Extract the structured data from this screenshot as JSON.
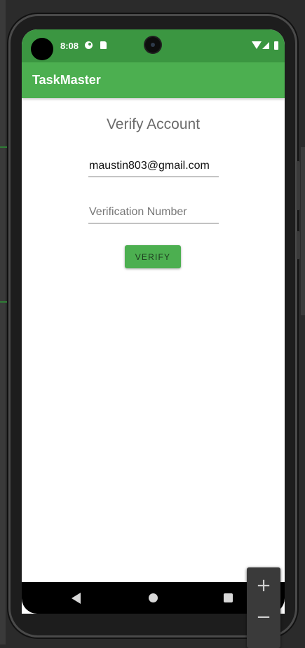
{
  "status_bar": {
    "time": "8:08"
  },
  "app_bar": {
    "title": "TaskMaster"
  },
  "form": {
    "heading": "Verify Account",
    "email_value": "maustin803@gmail.com",
    "code_placeholder": "Verification Number",
    "verify_label": "VERIFY"
  },
  "zoom": {
    "in_label": "+",
    "out_label": "−"
  },
  "colors": {
    "status_bar": "#3b9641",
    "app_bar": "#4caf50",
    "button": "#4caf50"
  }
}
